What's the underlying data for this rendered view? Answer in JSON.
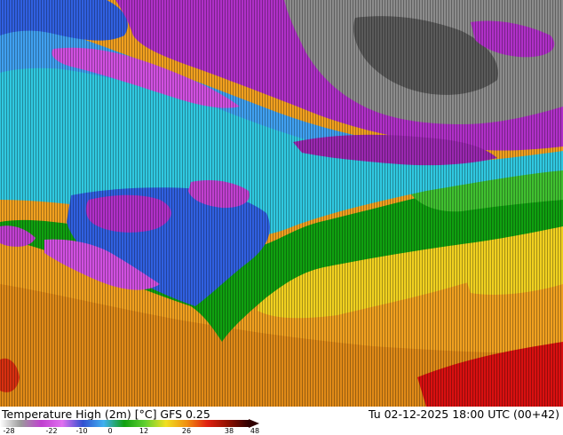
{
  "map": {
    "title": "Temperature High (2m) [°C] GFS 0.25",
    "timestamp": "Tu 02-12-2025 18:00 UTC (00+42)",
    "colors": {
      "cold_gray": "#8c8c8c",
      "dark_gray": "#5a5a5a",
      "purple": "#b030c8",
      "magenta": "#d050e0",
      "blue": "#3060e0",
      "light_blue": "#40a0f0",
      "cyan": "#30d0e8",
      "green": "#10a010",
      "light_green": "#40c030",
      "yellow": "#f0d020",
      "orange": "#f0a020",
      "dark_orange": "#e08010",
      "red": "#d81010"
    },
    "legend": {
      "ticks": [
        "-28",
        "-22",
        "-10",
        "0",
        "12",
        "26",
        "38",
        "48"
      ],
      "stops": [
        "#ffffff",
        "#9a9a9a",
        "#c040d0",
        "#e070f0",
        "#3050d0",
        "#40b0f0",
        "#10a010",
        "#60d030",
        "#f0e020",
        "#f09010",
        "#e02010",
        "#901000",
        "#300000"
      ]
    }
  }
}
